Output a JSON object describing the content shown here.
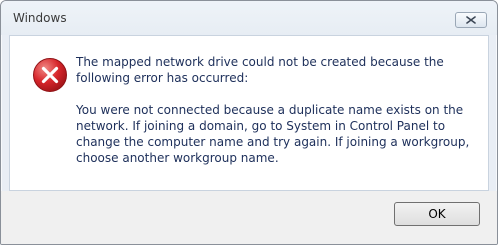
{
  "dialog": {
    "title": "Windows",
    "icon": "error-icon",
    "message_line1": "The mapped network drive could not be created because the following error has occurred:",
    "message_line2": "You were not connected because a duplicate name exists on the network. If joining a domain, go to System in Control Panel to change the computer name and try again. If joining a workgroup, choose another workgroup name.",
    "ok_label": "OK"
  },
  "colors": {
    "error_red": "#d7262b",
    "text_blue": "#1d2f5a"
  }
}
